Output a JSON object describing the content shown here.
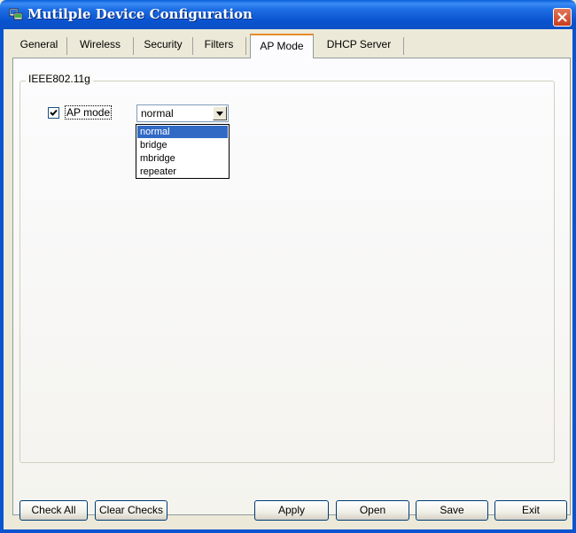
{
  "window": {
    "title": "Mutilple Device Configuration"
  },
  "tabs": [
    {
      "label": "General"
    },
    {
      "label": "Wireless"
    },
    {
      "label": "Security"
    },
    {
      "label": "Filters"
    },
    {
      "label": "AP Mode",
      "active": true
    },
    {
      "label": "DHCP Server"
    }
  ],
  "group": {
    "label": "IEEE802.11g"
  },
  "ap_mode": {
    "checkbox_label": "AP mode",
    "checked": true,
    "selected": "normal",
    "options": [
      "normal",
      "bridge",
      "mbridge",
      "repeater"
    ]
  },
  "buttons": {
    "check_all": "Check All",
    "clear_checks": "Clear Checks",
    "apply": "Apply",
    "open": "Open",
    "save": "Save",
    "exit": "Exit"
  },
  "colors": {
    "titlebar": "#0a54d0",
    "active_tab_accent": "#e68b2c",
    "selection": "#316ac5"
  }
}
